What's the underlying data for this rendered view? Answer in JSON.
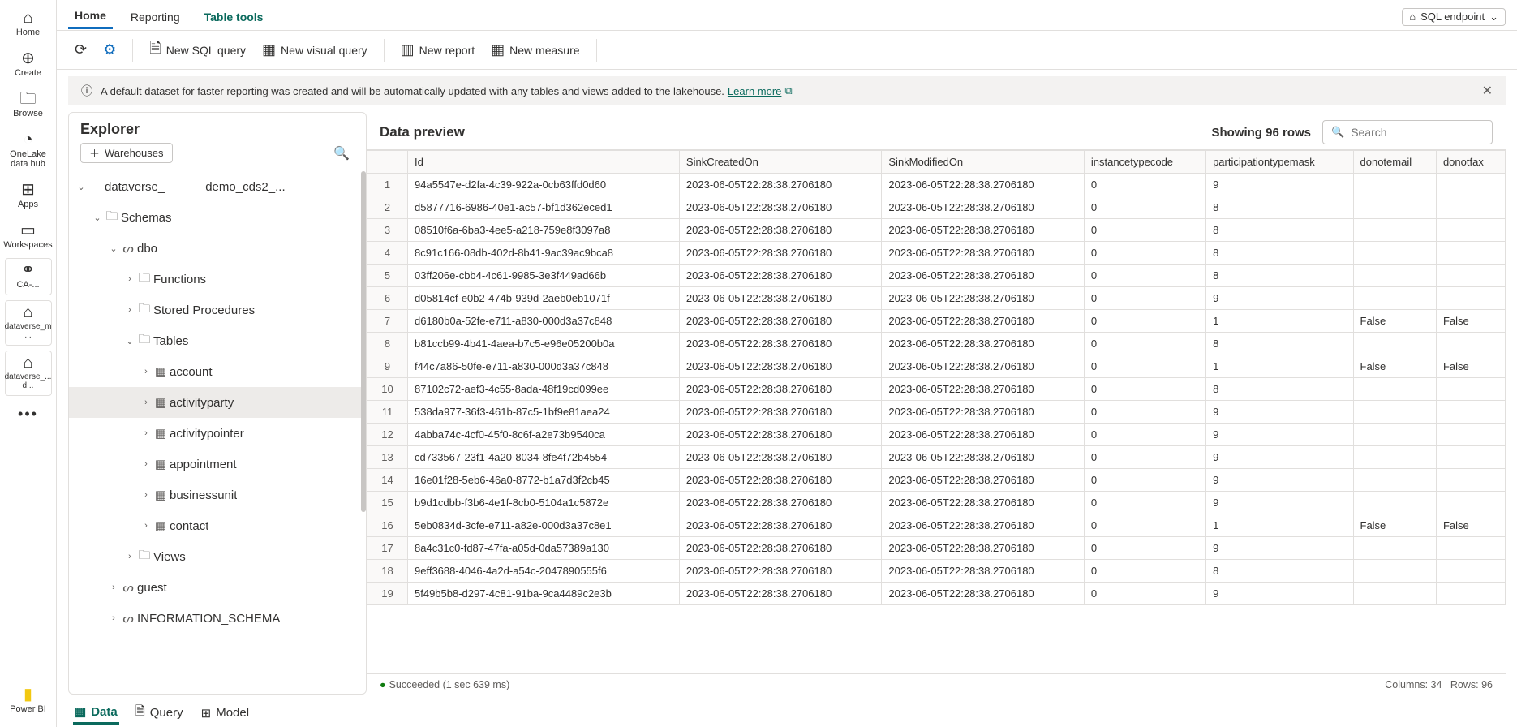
{
  "leftnav": {
    "home": "Home",
    "create": "Create",
    "browse": "Browse",
    "onelake": "OneLake data hub",
    "apps": "Apps",
    "workspaces": "Workspaces",
    "ca": "CA-...",
    "dataverse_m": "dataverse_m ...",
    "dataverse_d": "dataverse_... d...",
    "powerbi": "Power BI"
  },
  "ribbon": {
    "tabs": {
      "home": "Home",
      "reporting": "Reporting",
      "tools": "Table tools"
    },
    "endpoint": "SQL endpoint"
  },
  "toolbar": {
    "new_sql": "New SQL query",
    "new_visual": "New visual query",
    "new_report": "New report",
    "new_measure": "New measure"
  },
  "banner": {
    "text": "A default dataset for faster reporting was created and will be automatically updated with any tables and views added to the lakehouse.",
    "link": "Learn more"
  },
  "explorer": {
    "title": "Explorer",
    "warehouses": "Warehouses",
    "connection_prefix": "dataverse_",
    "connection_suffix": "demo_cds2_...",
    "schemas_label": "Schemas",
    "dbo": "dbo",
    "functions": "Functions",
    "stored_procs": "Stored Procedures",
    "tables_label": "Tables",
    "tables": {
      "account": "account",
      "activityparty": "activityparty",
      "activitypointer": "activitypointer",
      "appointment": "appointment",
      "businessunit": "businessunit",
      "contact": "contact"
    },
    "views": "Views",
    "guest": "guest",
    "info_schema": "INFORMATION_SCHEMA"
  },
  "preview": {
    "title": "Data preview",
    "count": "Showing 96 rows",
    "search_placeholder": "Search",
    "columns": [
      "Id",
      "SinkCreatedOn",
      "SinkModifiedOn",
      "instancetypecode",
      "participationtypemask",
      "donotemail",
      "donotfax"
    ],
    "rows": [
      [
        "94a5547e-d2fa-4c39-922a-0cb63ffd0d60",
        "2023-06-05T22:28:38.2706180",
        "2023-06-05T22:28:38.2706180",
        "0",
        "9",
        "",
        ""
      ],
      [
        "d5877716-6986-40e1-ac57-bf1d362eced1",
        "2023-06-05T22:28:38.2706180",
        "2023-06-05T22:28:38.2706180",
        "0",
        "8",
        "",
        ""
      ],
      [
        "08510f6a-6ba3-4ee5-a218-759e8f3097a8",
        "2023-06-05T22:28:38.2706180",
        "2023-06-05T22:28:38.2706180",
        "0",
        "8",
        "",
        ""
      ],
      [
        "8c91c166-08db-402d-8b41-9ac39ac9bca8",
        "2023-06-05T22:28:38.2706180",
        "2023-06-05T22:28:38.2706180",
        "0",
        "8",
        "",
        ""
      ],
      [
        "03ff206e-cbb4-4c61-9985-3e3f449ad66b",
        "2023-06-05T22:28:38.2706180",
        "2023-06-05T22:28:38.2706180",
        "0",
        "8",
        "",
        ""
      ],
      [
        "d05814cf-e0b2-474b-939d-2aeb0eb1071f",
        "2023-06-05T22:28:38.2706180",
        "2023-06-05T22:28:38.2706180",
        "0",
        "9",
        "",
        ""
      ],
      [
        "d6180b0a-52fe-e711-a830-000d3a37c848",
        "2023-06-05T22:28:38.2706180",
        "2023-06-05T22:28:38.2706180",
        "0",
        "1",
        "False",
        "False"
      ],
      [
        "b81ccb99-4b41-4aea-b7c5-e96e05200b0a",
        "2023-06-05T22:28:38.2706180",
        "2023-06-05T22:28:38.2706180",
        "0",
        "8",
        "",
        ""
      ],
      [
        "f44c7a86-50fe-e711-a830-000d3a37c848",
        "2023-06-05T22:28:38.2706180",
        "2023-06-05T22:28:38.2706180",
        "0",
        "1",
        "False",
        "False"
      ],
      [
        "87102c72-aef3-4c55-8ada-48f19cd099ee",
        "2023-06-05T22:28:38.2706180",
        "2023-06-05T22:28:38.2706180",
        "0",
        "8",
        "",
        ""
      ],
      [
        "538da977-36f3-461b-87c5-1bf9e81aea24",
        "2023-06-05T22:28:38.2706180",
        "2023-06-05T22:28:38.2706180",
        "0",
        "9",
        "",
        ""
      ],
      [
        "4abba74c-4cf0-45f0-8c6f-a2e73b9540ca",
        "2023-06-05T22:28:38.2706180",
        "2023-06-05T22:28:38.2706180",
        "0",
        "9",
        "",
        ""
      ],
      [
        "cd733567-23f1-4a20-8034-8fe4f72b4554",
        "2023-06-05T22:28:38.2706180",
        "2023-06-05T22:28:38.2706180",
        "0",
        "9",
        "",
        ""
      ],
      [
        "16e01f28-5eb6-46a0-8772-b1a7d3f2cb45",
        "2023-06-05T22:28:38.2706180",
        "2023-06-05T22:28:38.2706180",
        "0",
        "9",
        "",
        ""
      ],
      [
        "b9d1cdbb-f3b6-4e1f-8cb0-5104a1c5872e",
        "2023-06-05T22:28:38.2706180",
        "2023-06-05T22:28:38.2706180",
        "0",
        "9",
        "",
        ""
      ],
      [
        "5eb0834d-3cfe-e711-a82e-000d3a37c8e1",
        "2023-06-05T22:28:38.2706180",
        "2023-06-05T22:28:38.2706180",
        "0",
        "1",
        "False",
        "False"
      ],
      [
        "8a4c31c0-fd87-47fa-a05d-0da57389a130",
        "2023-06-05T22:28:38.2706180",
        "2023-06-05T22:28:38.2706180",
        "0",
        "9",
        "",
        ""
      ],
      [
        "9eff3688-4046-4a2d-a54c-2047890555f6",
        "2023-06-05T22:28:38.2706180",
        "2023-06-05T22:28:38.2706180",
        "0",
        "8",
        "",
        ""
      ],
      [
        "5f49b5b8-d297-4c81-91ba-9ca4489c2e3b",
        "2023-06-05T22:28:38.2706180",
        "2023-06-05T22:28:38.2706180",
        "0",
        "9",
        "",
        ""
      ]
    ]
  },
  "status": {
    "succeeded": "Succeeded (1 sec 639 ms)",
    "columns": "Columns: 34",
    "rows": "Rows: 96"
  },
  "bottom_tabs": {
    "data": "Data",
    "query": "Query",
    "model": "Model"
  }
}
